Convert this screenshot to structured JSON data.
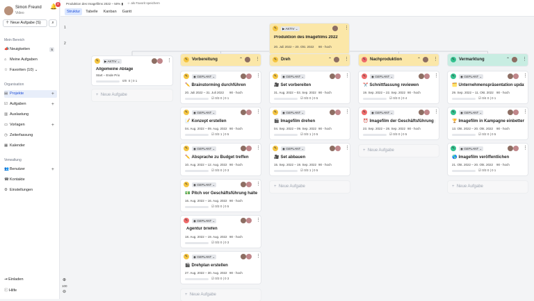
{
  "user": {
    "name": "Simon Freund",
    "role": "Video",
    "notifications": "3"
  },
  "sidebar": {
    "new_task": "Neue Aufgabe (S)",
    "section_main": "Mein Bereich",
    "main_items": [
      {
        "label": "Neuigkeiten",
        "badge": "5"
      },
      {
        "label": "Meine Aufgaben",
        "badge": ""
      },
      {
        "label": "Favoriten (10)",
        "badge": ""
      }
    ],
    "section_org": "Organisation",
    "org_items": [
      {
        "label": "Projekte"
      },
      {
        "label": "Aufgaben"
      },
      {
        "label": "Auslastung"
      },
      {
        "label": "Vorlagen"
      },
      {
        "label": "Zeiterfassung"
      },
      {
        "label": "Kalender"
      }
    ],
    "section_admin": "Verwaltung",
    "admin_items": [
      {
        "label": "Benutzer"
      },
      {
        "label": "Kontakte"
      },
      {
        "label": "Einstellungen"
      }
    ],
    "invite": "Einladen",
    "help": "Hilfe"
  },
  "topbar": {
    "breadcrumb": "Produktion des Imagefilms 2022 – 50%",
    "favorite": "als Favorit speichern",
    "tabs": [
      "Struktur",
      "Tabelle",
      "Kanban",
      "Gantt"
    ]
  },
  "canvas": {
    "level1": "1",
    "level2": "2",
    "zoom": "100"
  },
  "root": {
    "status": "AKTIV",
    "title": "Produktion des Imagefilms 2022",
    "dates": "20. Juli 2022 – 20. Okt. 2022",
    "hours": "90 - hoch"
  },
  "ablage": {
    "status": "AKTIV",
    "title": "Allgemeine Ablage",
    "meta": "Start – Ende     Prio",
    "progress": "0/0",
    "stats": "0 | 0   1",
    "add": "Neue Aufgabe"
  },
  "phases": [
    {
      "name": "Vorbereitung",
      "color": "#fbe7a8",
      "pen": "#f5c542",
      "add": "Neue Aufgabe",
      "tasks": [
        {
          "status": "GEPLANT",
          "icon": "✏️",
          "title": "Brainstorming durchführen",
          "dates": "20. Juli 2022 – 31. Juli 2022",
          "prio": "90 - hoch",
          "progress": "0/3",
          "stats": "0 | 0   1",
          "pen": "#f5c542"
        },
        {
          "status": "GEPLANT",
          "icon": "📝",
          "title": "Konzept erstellen",
          "dates": "04. Aug. 2022 – 09. Aug. 2022",
          "prio": "90 - hoch",
          "progress": "0/3",
          "stats": "1 | 0   5",
          "pen": "#f5c542"
        },
        {
          "status": "GEPLANT",
          "icon": "✏️",
          "title": "Absprache zu Budget treffen",
          "dates": "10. Aug. 2022 – 12. Aug. 2022",
          "prio": "90 - hoch",
          "progress": "0/3",
          "stats": "0 | 0   3",
          "pen": "#f5c542"
        },
        {
          "status": "GEPLANT",
          "icon": "💵",
          "title": "Pitch vor Geschäftsführung halten",
          "dates": "16. Aug. 2022 – 16. Aug. 2022",
          "prio": "90 - hoch",
          "progress": "0/3",
          "stats": "0 | 0   5",
          "pen": "#f5c542"
        },
        {
          "status": "GEPLANT",
          "icon": "",
          "title": "Agentur briefen",
          "dates": "18. Aug. 2022 – 19. Aug. 2022",
          "prio": "90 - hoch",
          "progress": "0/3",
          "stats": "0 | 0   3",
          "pen": "#ef6b6b"
        },
        {
          "status": "GEPLANT",
          "icon": "🎬",
          "title": "Drehplan erstellen",
          "dates": "27. Aug. 2022 – 30. Aug. 2022",
          "prio": "90 - hoch",
          "progress": "0/3",
          "stats": "0 | 0   3",
          "pen": "#f5c542"
        }
      ]
    },
    {
      "name": "Dreh",
      "color": "#fbe7a8",
      "pen": "#f5c542",
      "add": "Neue Aufgabe",
      "tasks": [
        {
          "status": "GEPLANT",
          "icon": "🎥",
          "title": "Set vorbereiten",
          "dates": "31. Aug. 2022 – 03. Sep. 2022",
          "prio": "90 - hoch",
          "progress": "0/3",
          "stats": "0 | 0   5",
          "pen": "#f5c542"
        },
        {
          "status": "GEPLANT",
          "icon": "🎬",
          "title": "Imagefilm drehen",
          "dates": "04. Sep. 2022 – 09. Sep. 2022",
          "prio": "90 - hoch",
          "progress": "0/3",
          "stats": "1 | 0   5",
          "pen": "#f5c542"
        },
        {
          "status": "GEPLANT",
          "icon": "🎥",
          "title": "Set abbauen",
          "dates": "15. Sep. 2022 – 19. Sep. 2022",
          "prio": "90 - hoch",
          "progress": "0/3",
          "stats": "1 | 0   5",
          "pen": "#f5c542"
        }
      ]
    },
    {
      "name": "Nachproduktion",
      "color": "#fbe7a8",
      "pen": "#ef6b6b",
      "add": "Neue Aufgabe",
      "tasks": [
        {
          "status": "GEPLANT",
          "icon": "✂️",
          "title": "Schnittfassung reviewen",
          "dates": "19. Sep. 2022 – 22. Sep. 2022",
          "prio": "90 - hoch",
          "progress": "0/3",
          "stats": "0 | 0   4",
          "pen": "#ef6b6b"
        },
        {
          "status": "GEPLANT",
          "icon": "⏰",
          "title": "Imagefilm der Geschäftsführung p…",
          "dates": "23. Sep. 2022 – 28. Sep. 2022",
          "prio": "90 - hoch",
          "progress": "0/3",
          "stats": "0 | 0   5",
          "pen": "#ef6b6b"
        }
      ]
    },
    {
      "name": "Vermarktung",
      "color": "#c8ede2",
      "pen": "#34c28f",
      "add": "Neue Aufgabe",
      "tasks": [
        {
          "status": "GEPLANT",
          "icon": "🗂️",
          "title": "Unternehmenspräsentation updat…",
          "dates": "29. Sep. 2022 – 11. Okt. 2022",
          "prio": "90 - hoch",
          "progress": "0/4",
          "stats": "0 | 0   1",
          "pen": "#34c28f"
        },
        {
          "status": "GEPLANT",
          "icon": "🏆",
          "title": "Imagefilm in Kampagne einbetten",
          "dates": "13. Okt. 2022 – 20. Okt. 2022",
          "prio": "90 - hoch",
          "progress": "0/2",
          "stats": "0 | 0   5",
          "pen": "#34c28f"
        },
        {
          "status": "GEPLANT",
          "icon": "🌎",
          "title": "Imagefilm veröffentlichen",
          "dates": "21. Okt. 2022 – 20. Okt. 2022",
          "prio": "90 - hoch",
          "progress": "0/3",
          "stats": "0 | 0   1",
          "pen": "#34c28f"
        }
      ]
    }
  ]
}
